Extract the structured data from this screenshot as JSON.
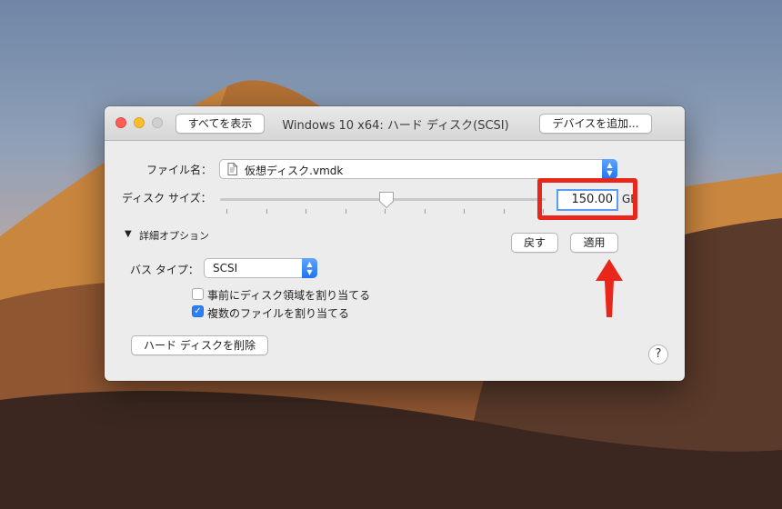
{
  "window": {
    "title": "Windows 10 x64: ハード ディスク(SCSI)",
    "show_all_label": "すべてを表示",
    "add_device_label": "デバイスを追加..."
  },
  "disk": {
    "filename_label": "ファイル名：",
    "filename_value": "仮想ディスク.vmdk",
    "size_label": "ディスク サイズ：",
    "size_value": "150.00",
    "size_unit": "GB",
    "slider_fraction": 0.51
  },
  "advanced": {
    "toggle_label": "詳細オプション",
    "revert_label": "戻す",
    "apply_label": "適用",
    "bus_type_label": "バス タイプ：",
    "bus_type_value": "SCSI",
    "checkbox_preallocate": {
      "label": "事前にディスク領域を割り当てる",
      "checked": false
    },
    "checkbox_split": {
      "label": "複数のファイルを割り当てる",
      "checked": true
    }
  },
  "footer": {
    "remove_disk_label": "ハード ディスクを削除",
    "help_label": "?"
  },
  "colors": {
    "annotation_red": "#e8261b",
    "accent_blue": "#2d7ef7"
  }
}
